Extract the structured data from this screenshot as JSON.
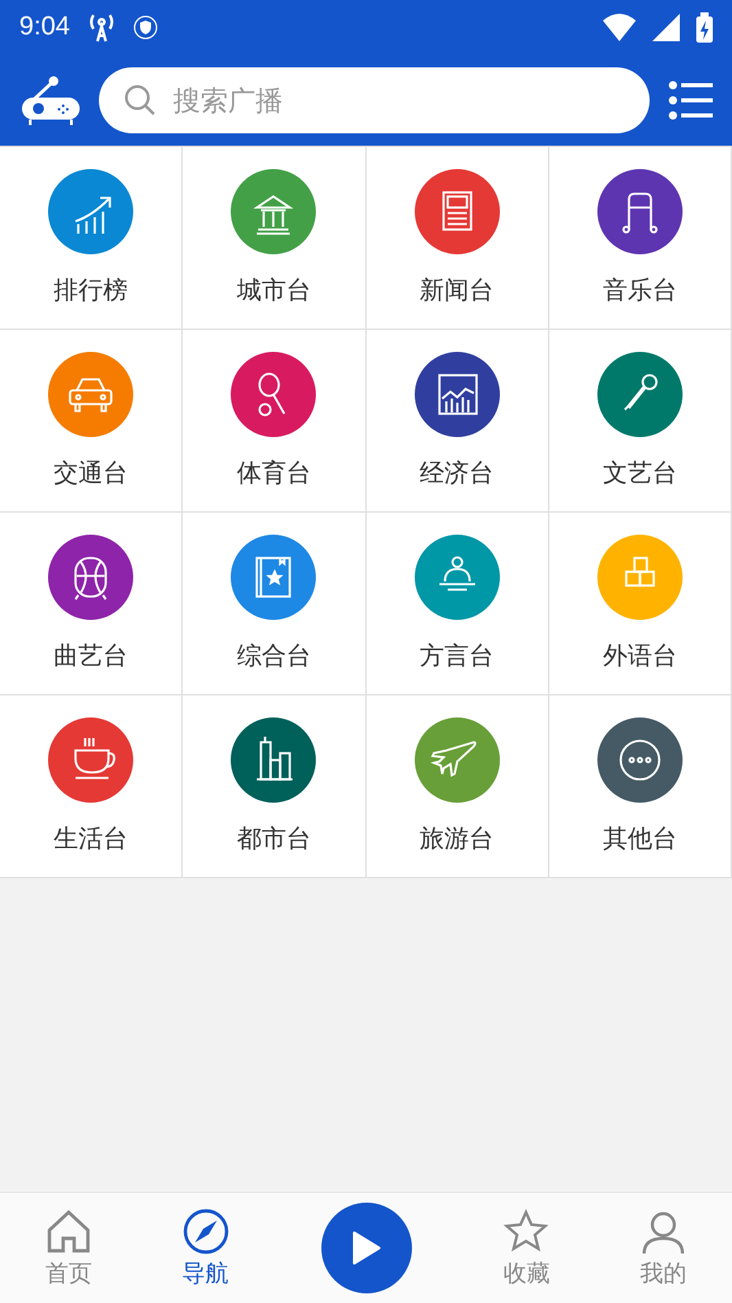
{
  "status_bar": {
    "time": "9:04"
  },
  "search": {
    "placeholder": "搜索广播"
  },
  "categories": [
    {
      "label": "排行榜",
      "kind": "ranking",
      "color": "#0a88d4"
    },
    {
      "label": "城市台",
      "kind": "building",
      "color": "#43a047"
    },
    {
      "label": "新闻台",
      "kind": "news",
      "color": "#e53935"
    },
    {
      "label": "音乐台",
      "kind": "music",
      "color": "#5e35b1"
    },
    {
      "label": "交通台",
      "kind": "car",
      "color": "#f57c00"
    },
    {
      "label": "体育台",
      "kind": "sport",
      "color": "#d81b60"
    },
    {
      "label": "经济台",
      "kind": "economy",
      "color": "#303f9f"
    },
    {
      "label": "文艺台",
      "kind": "mic",
      "color": "#00796b"
    },
    {
      "label": "曲艺台",
      "kind": "opera",
      "color": "#8e24aa"
    },
    {
      "label": "综合台",
      "kind": "book",
      "color": "#1e88e5"
    },
    {
      "label": "方言台",
      "kind": "speaker",
      "color": "#0097a7"
    },
    {
      "label": "外语台",
      "kind": "blocks",
      "color": "#ffb300"
    },
    {
      "label": "生活台",
      "kind": "cup",
      "color": "#e53935"
    },
    {
      "label": "都市台",
      "kind": "city",
      "color": "#00605a"
    },
    {
      "label": "旅游台",
      "kind": "plane",
      "color": "#689f38"
    },
    {
      "label": "其他台",
      "kind": "more",
      "color": "#455a64"
    }
  ],
  "nav": [
    {
      "label": "首页",
      "kind": "home",
      "selected": false
    },
    {
      "label": "导航",
      "kind": "compass",
      "selected": true
    },
    {
      "kind": "play"
    },
    {
      "label": "收藏",
      "kind": "star",
      "selected": false
    },
    {
      "label": "我的",
      "kind": "user",
      "selected": false
    }
  ]
}
